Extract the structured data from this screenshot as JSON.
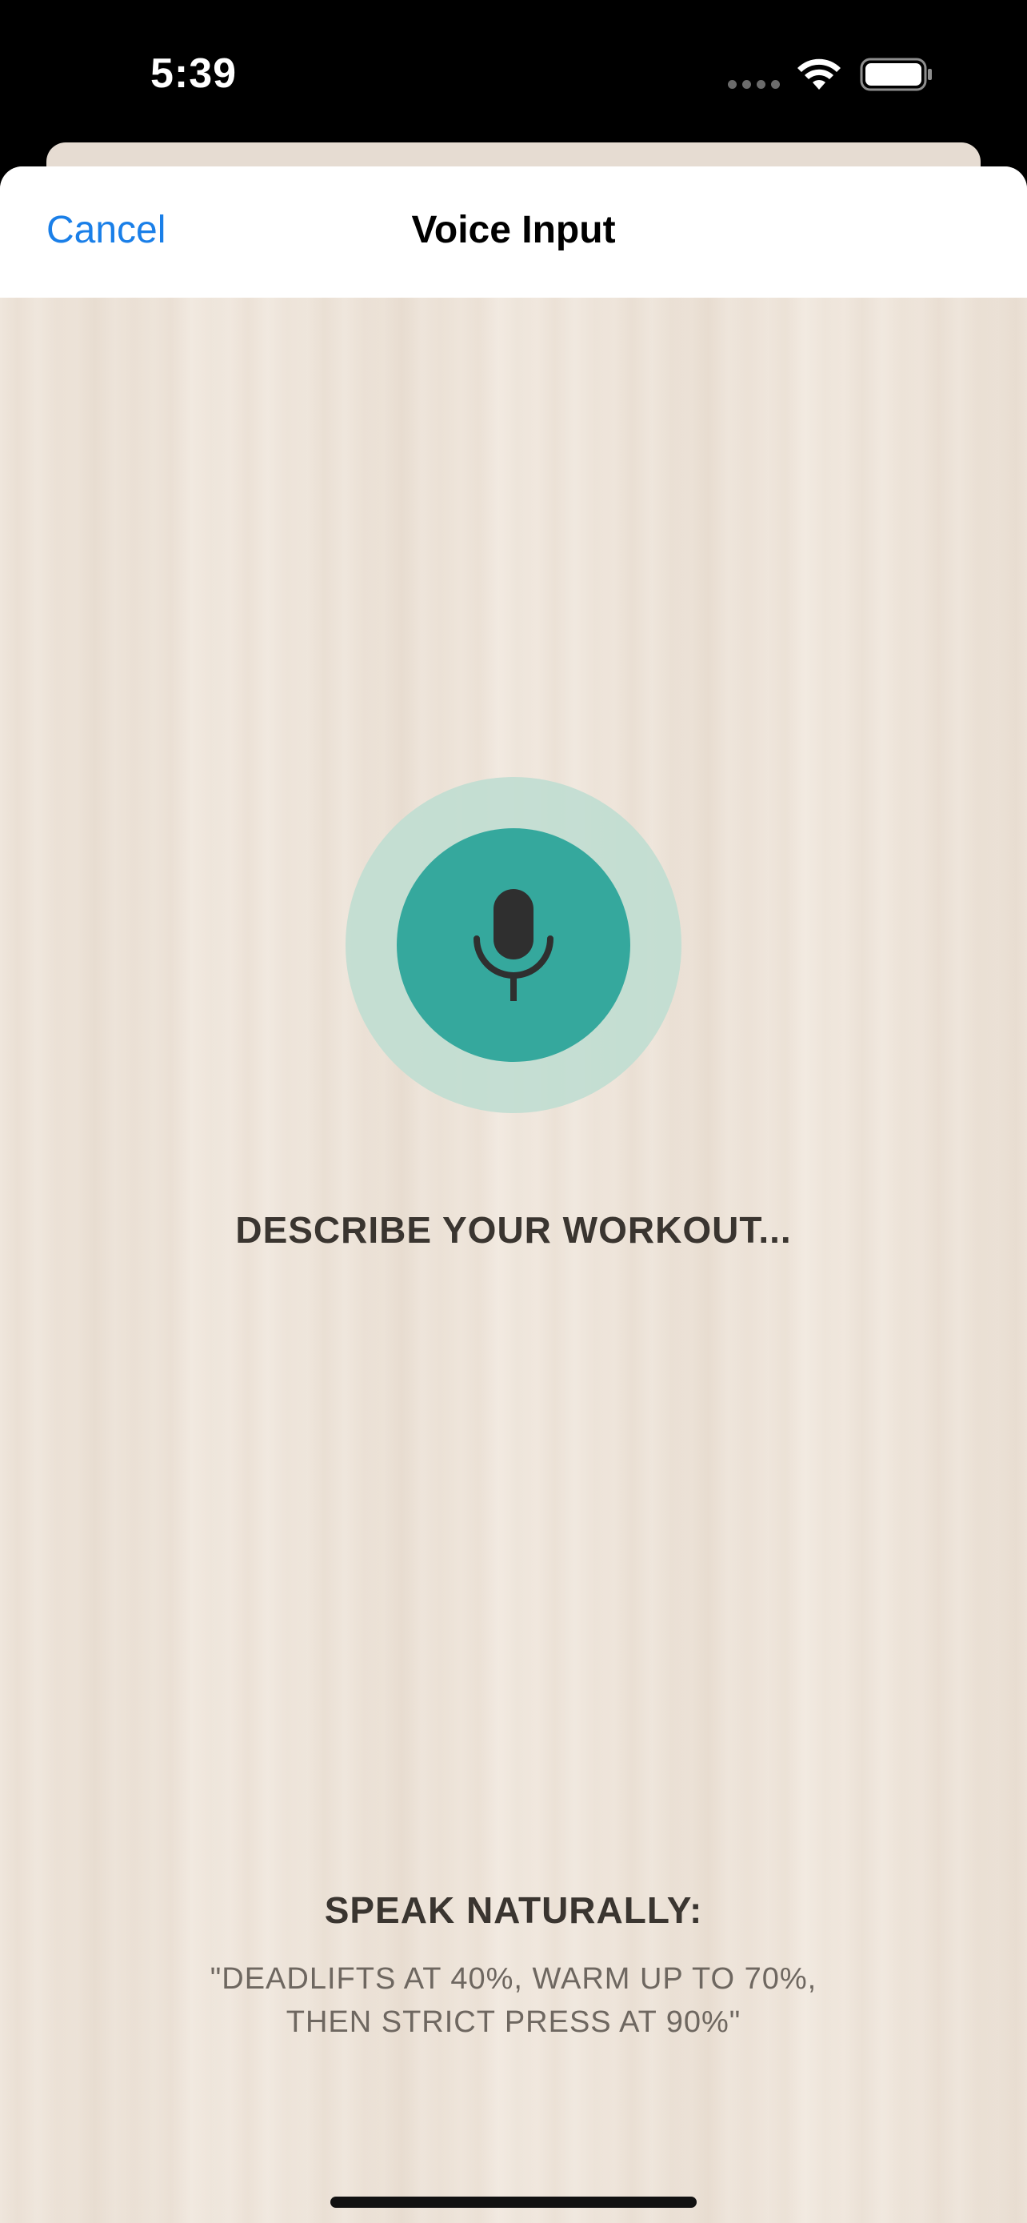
{
  "status_bar": {
    "time": "5:39",
    "icons": [
      "signal-icon",
      "wifi-icon",
      "battery-icon"
    ]
  },
  "nav": {
    "cancel_label": "Cancel",
    "title": "Voice Input"
  },
  "mic": {
    "icon": "microphone-icon",
    "accent_color": "#35a89d",
    "halo_color": "#c2ddd2"
  },
  "prompt": "DESCRIBE YOUR WORKOUT...",
  "tip": {
    "heading": "SPEAK NATURALLY:",
    "example_line1": "\"DEADLIFTS AT 40%, WARM UP TO 70%,",
    "example_line2": "THEN STRICT PRESS AT 90%\""
  },
  "colors": {
    "link": "#1a7fe8",
    "background": "#efe6dc",
    "text": "#3a3530"
  }
}
